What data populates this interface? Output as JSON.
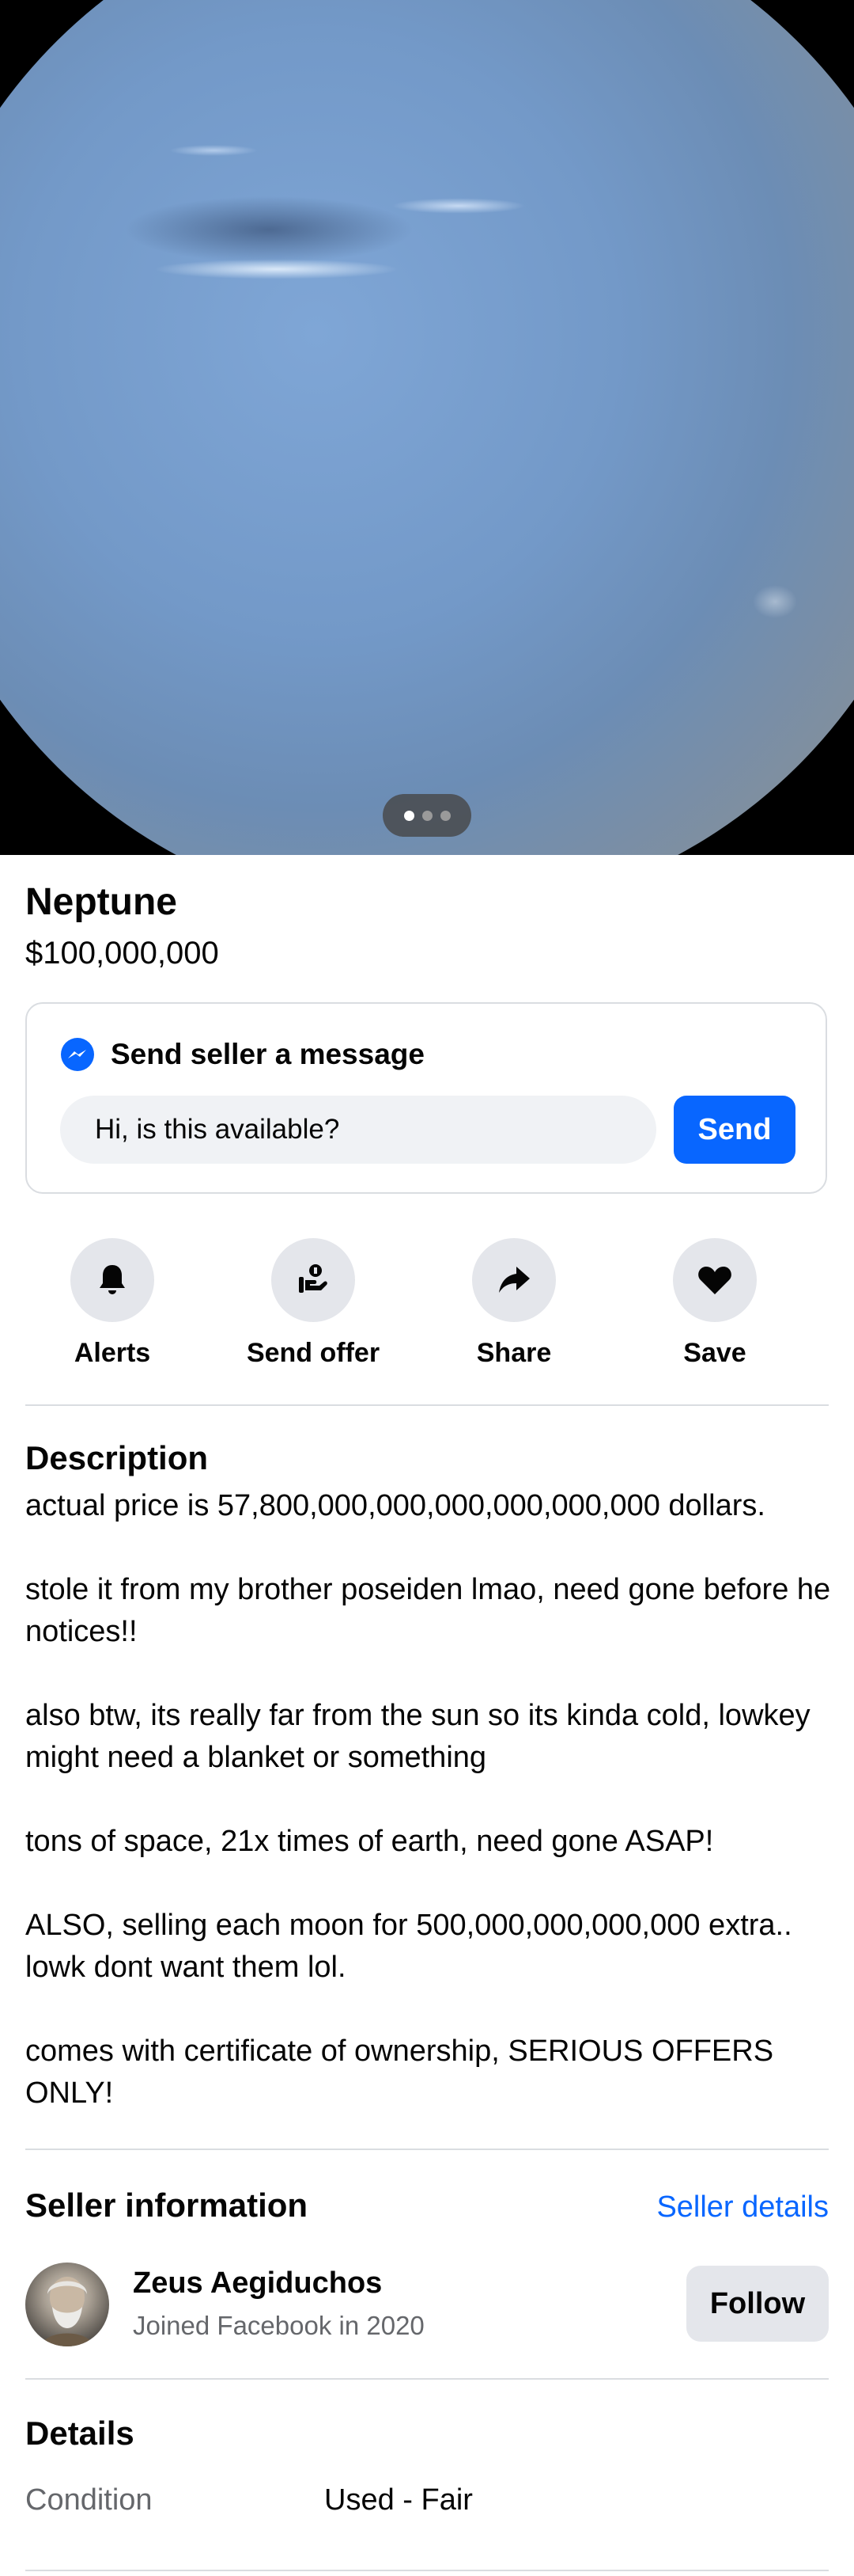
{
  "listing": {
    "image_dots": [
      true,
      false,
      false
    ],
    "title": "Neptune",
    "price": "$100,000,000"
  },
  "message": {
    "heading": "Send seller a message",
    "input_value": "Hi, is this available?",
    "send_label": "Send"
  },
  "actions": [
    {
      "label": "Alerts",
      "icon": "bell-icon"
    },
    {
      "label": "Send offer",
      "icon": "offer-hand-icon"
    },
    {
      "label": "Share",
      "icon": "share-arrow-icon"
    },
    {
      "label": "Save",
      "icon": "heart-icon"
    }
  ],
  "description": {
    "heading": "Description",
    "paragraphs": [
      "actual price is 57,800,000,000,000,000,000,000 dollars.",
      "stole it from my brother poseiden lmao, need gone before he notices!!",
      "also btw, its really far from the sun so its kinda cold, lowkey might need a blanket or something",
      "tons of space, 21x times of earth, need gone ASAP!",
      "ALSO, selling each moon for 500,000,000,000,000 extra.. lowk dont want them lol.",
      "comes with certificate of ownership, SERIOUS OFFERS ONLY!"
    ]
  },
  "seller": {
    "heading": "Seller information",
    "details_link": "Seller details",
    "name": "Zeus Aegiduchos",
    "joined": "Joined Facebook in 2020",
    "follow_label": "Follow"
  },
  "details": {
    "heading": "Details",
    "rows": [
      {
        "key": "Condition",
        "value": "Used - Fair"
      }
    ]
  },
  "colors": {
    "accent": "#0866ff",
    "button_gray": "#e4e6eb",
    "secondary_text": "#65676b"
  }
}
